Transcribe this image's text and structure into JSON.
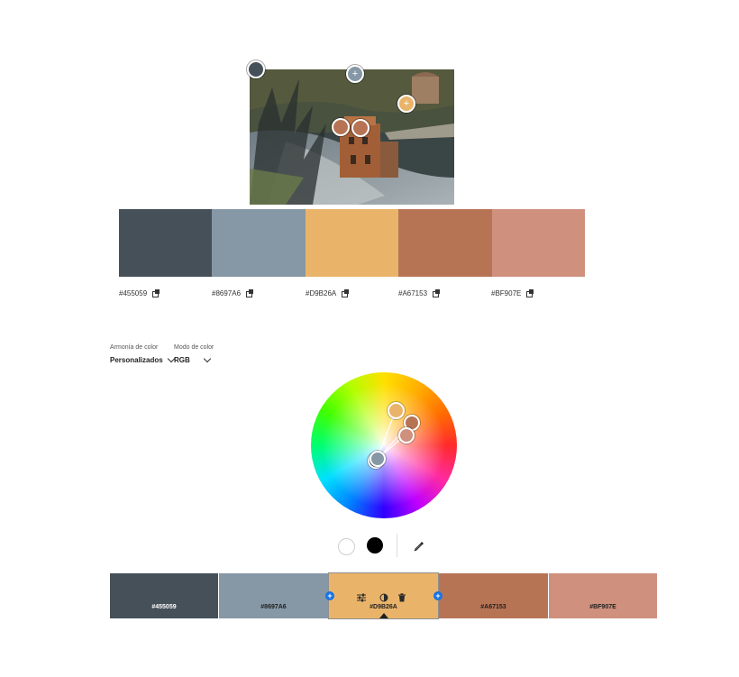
{
  "colors": [
    {
      "hex": "#455059",
      "css": "#455059",
      "label_color": "#ffffff"
    },
    {
      "hex": "#8697A6",
      "css": "#8697A6",
      "label_color": "#1f1f1f"
    },
    {
      "hex": "#D9B26A",
      "css": "#E9B46A",
      "label_color": "#1f1f1f"
    },
    {
      "hex": "#A67153",
      "css": "#B77455",
      "label_color": "#1f1f1f"
    },
    {
      "hex": "#BF907E",
      "css": "#CF907E",
      "label_color": "#1f1f1f"
    }
  ],
  "harmony": {
    "label": "Armonía de color",
    "value": "Personalizados"
  },
  "color_mode": {
    "label": "Modo de color",
    "value": "RGB"
  },
  "icons": {
    "copy": "copy-icon",
    "chevron": "chevron-down-icon",
    "adjust": "sliders-icon",
    "contrast": "contrast-icon",
    "delete": "trash-icon",
    "eyedropper": "eyedropper-icon",
    "add": "plus-icon"
  },
  "selected_index": 2
}
